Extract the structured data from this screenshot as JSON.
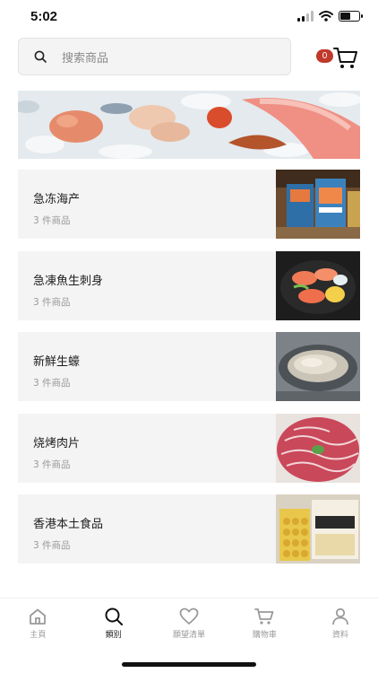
{
  "status_bar": {
    "time": "5:02",
    "battery_level": 0.55
  },
  "search": {
    "placeholder": "搜索商品",
    "icon": "search-icon"
  },
  "cart": {
    "badge_count": "0",
    "icon": "cart-icon",
    "badge_color": "#c0392b"
  },
  "banner": {
    "subject": "seafood-on-ice-image"
  },
  "categories": [
    {
      "name": "急冻海产",
      "count": "3 件商品",
      "thumb": "frozen-seafood-packages-image"
    },
    {
      "name": "急凍魚生刺身",
      "count": "3 件商品",
      "thumb": "sashimi-platter-image"
    },
    {
      "name": "新鮮生蠔",
      "count": "3 件商品",
      "thumb": "fresh-oyster-image"
    },
    {
      "name": "烧烤肉片",
      "count": "3 件商品",
      "thumb": "sliced-bbq-meat-image"
    },
    {
      "name": "香港本土食品",
      "count": "3 件商品",
      "thumb": "local-snack-packages-image"
    }
  ],
  "tab_bar": {
    "active_index": 1,
    "tabs": [
      {
        "label": "主頁",
        "icon": "home-icon"
      },
      {
        "label": "類別",
        "icon": "search-icon"
      },
      {
        "label": "願望清單",
        "icon": "heart-icon"
      },
      {
        "label": "購物車",
        "icon": "cart-icon"
      },
      {
        "label": "資料",
        "icon": "user-icon"
      }
    ]
  }
}
